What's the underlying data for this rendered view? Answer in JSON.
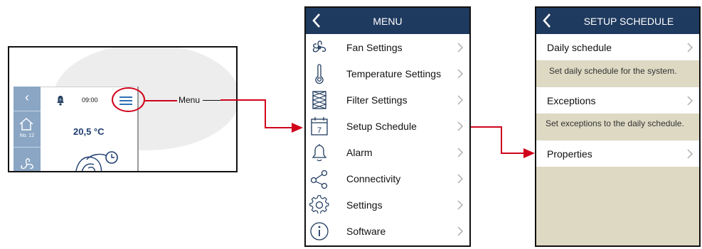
{
  "colors": {
    "header": "#1f3a5f",
    "highlight": "#d0021b",
    "panel_bg": "#ddd9c3"
  },
  "device": {
    "time": "09:00",
    "temperature": "20,5 °C",
    "zone_label": "No. 12",
    "callout_label": "Menu"
  },
  "menu": {
    "title": "MENU",
    "items": [
      {
        "label": "Fan Settings",
        "icon": "fan-icon"
      },
      {
        "label": "Temperature Settings",
        "icon": "thermometer-icon"
      },
      {
        "label": "Filter Settings",
        "icon": "filter-icon"
      },
      {
        "label": "Setup Schedule",
        "icon": "calendar-icon",
        "calendar_day": "7"
      },
      {
        "label": "Alarm",
        "icon": "bell-icon"
      },
      {
        "label": "Connectivity",
        "icon": "share-icon"
      },
      {
        "label": "Settings",
        "icon": "gear-icon"
      },
      {
        "label": "Software",
        "icon": "info-icon"
      }
    ]
  },
  "schedule": {
    "title": "SETUP SCHEDULE",
    "daily_label": "Daily schedule",
    "daily_desc": "Set daily schedule for the system.",
    "exceptions_label": "Exceptions",
    "exceptions_desc": "Set exceptions to the daily schedule.",
    "properties_label": "Properties"
  }
}
